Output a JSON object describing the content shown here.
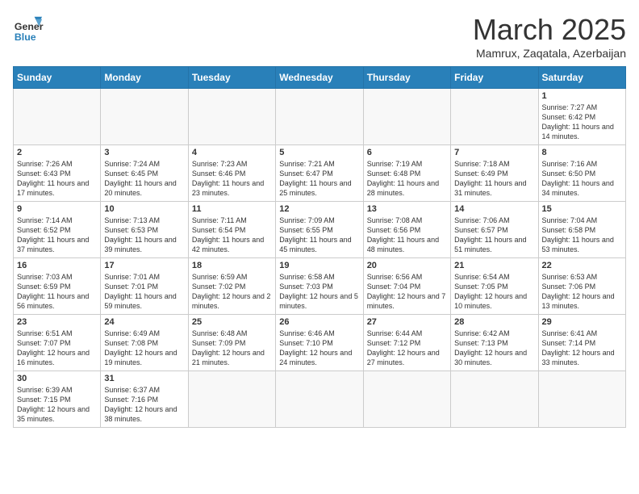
{
  "logo": {
    "line1": "General",
    "line2": "Blue"
  },
  "header": {
    "title": "March 2025",
    "subtitle": "Mamrux, Zaqatala, Azerbaijan"
  },
  "weekdays": [
    "Sunday",
    "Monday",
    "Tuesday",
    "Wednesday",
    "Thursday",
    "Friday",
    "Saturday"
  ],
  "days": [
    {
      "num": "",
      "info": ""
    },
    {
      "num": "",
      "info": ""
    },
    {
      "num": "",
      "info": ""
    },
    {
      "num": "",
      "info": ""
    },
    {
      "num": "",
      "info": ""
    },
    {
      "num": "",
      "info": ""
    },
    {
      "num": "1",
      "info": "Sunrise: 7:27 AM\nSunset: 6:42 PM\nDaylight: 11 hours and 14 minutes."
    },
    {
      "num": "2",
      "info": "Sunrise: 7:26 AM\nSunset: 6:43 PM\nDaylight: 11 hours and 17 minutes."
    },
    {
      "num": "3",
      "info": "Sunrise: 7:24 AM\nSunset: 6:45 PM\nDaylight: 11 hours and 20 minutes."
    },
    {
      "num": "4",
      "info": "Sunrise: 7:23 AM\nSunset: 6:46 PM\nDaylight: 11 hours and 23 minutes."
    },
    {
      "num": "5",
      "info": "Sunrise: 7:21 AM\nSunset: 6:47 PM\nDaylight: 11 hours and 25 minutes."
    },
    {
      "num": "6",
      "info": "Sunrise: 7:19 AM\nSunset: 6:48 PM\nDaylight: 11 hours and 28 minutes."
    },
    {
      "num": "7",
      "info": "Sunrise: 7:18 AM\nSunset: 6:49 PM\nDaylight: 11 hours and 31 minutes."
    },
    {
      "num": "8",
      "info": "Sunrise: 7:16 AM\nSunset: 6:50 PM\nDaylight: 11 hours and 34 minutes."
    },
    {
      "num": "9",
      "info": "Sunrise: 7:14 AM\nSunset: 6:52 PM\nDaylight: 11 hours and 37 minutes."
    },
    {
      "num": "10",
      "info": "Sunrise: 7:13 AM\nSunset: 6:53 PM\nDaylight: 11 hours and 39 minutes."
    },
    {
      "num": "11",
      "info": "Sunrise: 7:11 AM\nSunset: 6:54 PM\nDaylight: 11 hours and 42 minutes."
    },
    {
      "num": "12",
      "info": "Sunrise: 7:09 AM\nSunset: 6:55 PM\nDaylight: 11 hours and 45 minutes."
    },
    {
      "num": "13",
      "info": "Sunrise: 7:08 AM\nSunset: 6:56 PM\nDaylight: 11 hours and 48 minutes."
    },
    {
      "num": "14",
      "info": "Sunrise: 7:06 AM\nSunset: 6:57 PM\nDaylight: 11 hours and 51 minutes."
    },
    {
      "num": "15",
      "info": "Sunrise: 7:04 AM\nSunset: 6:58 PM\nDaylight: 11 hours and 53 minutes."
    },
    {
      "num": "16",
      "info": "Sunrise: 7:03 AM\nSunset: 6:59 PM\nDaylight: 11 hours and 56 minutes."
    },
    {
      "num": "17",
      "info": "Sunrise: 7:01 AM\nSunset: 7:01 PM\nDaylight: 11 hours and 59 minutes."
    },
    {
      "num": "18",
      "info": "Sunrise: 6:59 AM\nSunset: 7:02 PM\nDaylight: 12 hours and 2 minutes."
    },
    {
      "num": "19",
      "info": "Sunrise: 6:58 AM\nSunset: 7:03 PM\nDaylight: 12 hours and 5 minutes."
    },
    {
      "num": "20",
      "info": "Sunrise: 6:56 AM\nSunset: 7:04 PM\nDaylight: 12 hours and 7 minutes."
    },
    {
      "num": "21",
      "info": "Sunrise: 6:54 AM\nSunset: 7:05 PM\nDaylight: 12 hours and 10 minutes."
    },
    {
      "num": "22",
      "info": "Sunrise: 6:53 AM\nSunset: 7:06 PM\nDaylight: 12 hours and 13 minutes."
    },
    {
      "num": "23",
      "info": "Sunrise: 6:51 AM\nSunset: 7:07 PM\nDaylight: 12 hours and 16 minutes."
    },
    {
      "num": "24",
      "info": "Sunrise: 6:49 AM\nSunset: 7:08 PM\nDaylight: 12 hours and 19 minutes."
    },
    {
      "num": "25",
      "info": "Sunrise: 6:48 AM\nSunset: 7:09 PM\nDaylight: 12 hours and 21 minutes."
    },
    {
      "num": "26",
      "info": "Sunrise: 6:46 AM\nSunset: 7:10 PM\nDaylight: 12 hours and 24 minutes."
    },
    {
      "num": "27",
      "info": "Sunrise: 6:44 AM\nSunset: 7:12 PM\nDaylight: 12 hours and 27 minutes."
    },
    {
      "num": "28",
      "info": "Sunrise: 6:42 AM\nSunset: 7:13 PM\nDaylight: 12 hours and 30 minutes."
    },
    {
      "num": "29",
      "info": "Sunrise: 6:41 AM\nSunset: 7:14 PM\nDaylight: 12 hours and 33 minutes."
    },
    {
      "num": "30",
      "info": "Sunrise: 6:39 AM\nSunset: 7:15 PM\nDaylight: 12 hours and 35 minutes."
    },
    {
      "num": "31",
      "info": "Sunrise: 6:37 AM\nSunset: 7:16 PM\nDaylight: 12 hours and 38 minutes."
    },
    {
      "num": "",
      "info": ""
    },
    {
      "num": "",
      "info": ""
    },
    {
      "num": "",
      "info": ""
    },
    {
      "num": "",
      "info": ""
    },
    {
      "num": "",
      "info": ""
    }
  ]
}
